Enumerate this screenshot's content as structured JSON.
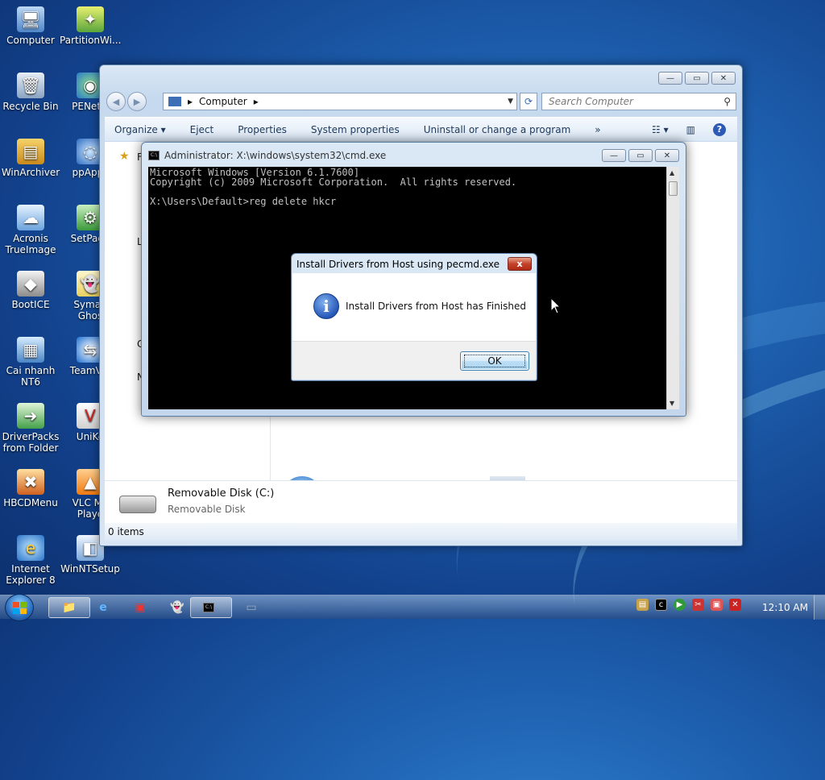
{
  "desktop": {
    "icons": [
      {
        "label": "Computer",
        "icon": "computer-icon"
      },
      {
        "label": "PartitionWi...",
        "icon": "partition-wizard-icon"
      },
      {
        "label": "Recycle Bin",
        "icon": "recycle-bin-icon"
      },
      {
        "label": "PENetw",
        "icon": "pe-network-icon"
      },
      {
        "label": "WinArchiver",
        "icon": "winarchiver-icon"
      },
      {
        "label": "ppApps",
        "icon": "ppapps-icon"
      },
      {
        "label": "Acronis\nTrueImage",
        "icon": "acronis-icon"
      },
      {
        "label": "SetPage",
        "icon": "setpage-icon"
      },
      {
        "label": "BootICE",
        "icon": "bootice-icon"
      },
      {
        "label": "Syman\nGhos",
        "icon": "symantec-ghost-icon"
      },
      {
        "label": "Cai nhanh\nNT6",
        "icon": "install-nt6-icon"
      },
      {
        "label": "TeamVie",
        "icon": "teamviewer-icon"
      },
      {
        "label": "DriverPacks\nfrom Folder",
        "icon": "driverpacks-icon"
      },
      {
        "label": "UniKe",
        "icon": "unikey-icon"
      },
      {
        "label": "HBCDMenu",
        "icon": "hbcd-menu-icon"
      },
      {
        "label": "VLC Me\nPlaye",
        "icon": "vlc-icon"
      },
      {
        "label": "Internet\nExplorer 8",
        "icon": "internet-explorer-icon"
      },
      {
        "label": "WinNTSetup",
        "icon": "winntsetup-icon"
      }
    ]
  },
  "explorer": {
    "address": "Computer",
    "search_placeholder": "Search Computer",
    "commands": [
      "Organize",
      "Eject",
      "Properties",
      "System properties",
      "Uninstall or change a program"
    ],
    "more": "»",
    "drive": {
      "name": "Removable Disk (C:)",
      "type": "Removable Disk"
    },
    "status": "0 items",
    "nav_partials": [
      "F",
      "L",
      "C",
      "N"
    ]
  },
  "cmd": {
    "title": "Administrator: X:\\windows\\system32\\cmd.exe",
    "lines": [
      "Microsoft Windows [Version 6.1.7600]",
      "Copyright (c) 2009 Microsoft Corporation.  All rights reserved.",
      "",
      "X:\\Users\\Default>reg delete hkcr"
    ]
  },
  "dialog": {
    "title": "Install Drivers from Host using pecmd.exe",
    "message": "Install Drivers from Host has Finished",
    "ok_label": "OK",
    "close_glyph": "x"
  },
  "taskbar": {
    "clock": "12:10 AM"
  },
  "colors": {
    "desktop_bg": "#1d5fae",
    "console_bg": "#000000",
    "console_fg": "#c0c0c0",
    "close_red": "#c4422a"
  }
}
